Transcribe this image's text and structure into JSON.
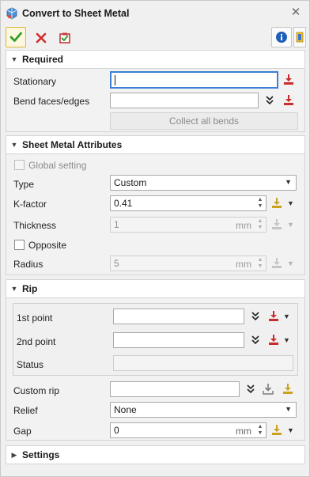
{
  "window": {
    "title": "Convert to Sheet Metal"
  },
  "toolbar": {
    "ok": "ok",
    "cancel": "cancel",
    "apply": "apply",
    "info": "info",
    "help": "help"
  },
  "sections": {
    "required": {
      "title": "Required",
      "stationary_label": "Stationary",
      "stationary_value": "",
      "bend_label": "Bend faces/edges",
      "bend_value": "",
      "collect_button": "Collect all bends"
    },
    "attributes": {
      "title": "Sheet Metal Attributes",
      "global_setting": "Global setting",
      "type_label": "Type",
      "type_value": "Custom",
      "kfactor_label": "K-factor",
      "kfactor_value": "0.41",
      "thickness_label": "Thickness",
      "thickness_value": "1",
      "thickness_unit": "mm",
      "opposite_label": "Opposite",
      "radius_label": "Radius",
      "radius_value": "5",
      "radius_unit": "mm"
    },
    "rip": {
      "title": "Rip",
      "first_point_label": "1st point",
      "first_point_value": "",
      "second_point_label": "2nd point",
      "second_point_value": "",
      "status_label": "Status",
      "status_value": "",
      "custom_rip_label": "Custom rip",
      "custom_rip_value": "",
      "relief_label": "Relief",
      "relief_value": "None",
      "gap_label": "Gap",
      "gap_value": "0",
      "gap_unit": "mm"
    },
    "settings": {
      "title": "Settings"
    }
  },
  "colors": {
    "accent_blue": "#3c7fd6",
    "check_green": "#2f9e2f",
    "cancel_red": "#d42a2a",
    "pick_red": "#c82c2c",
    "pick_gold": "#c9a21e"
  }
}
